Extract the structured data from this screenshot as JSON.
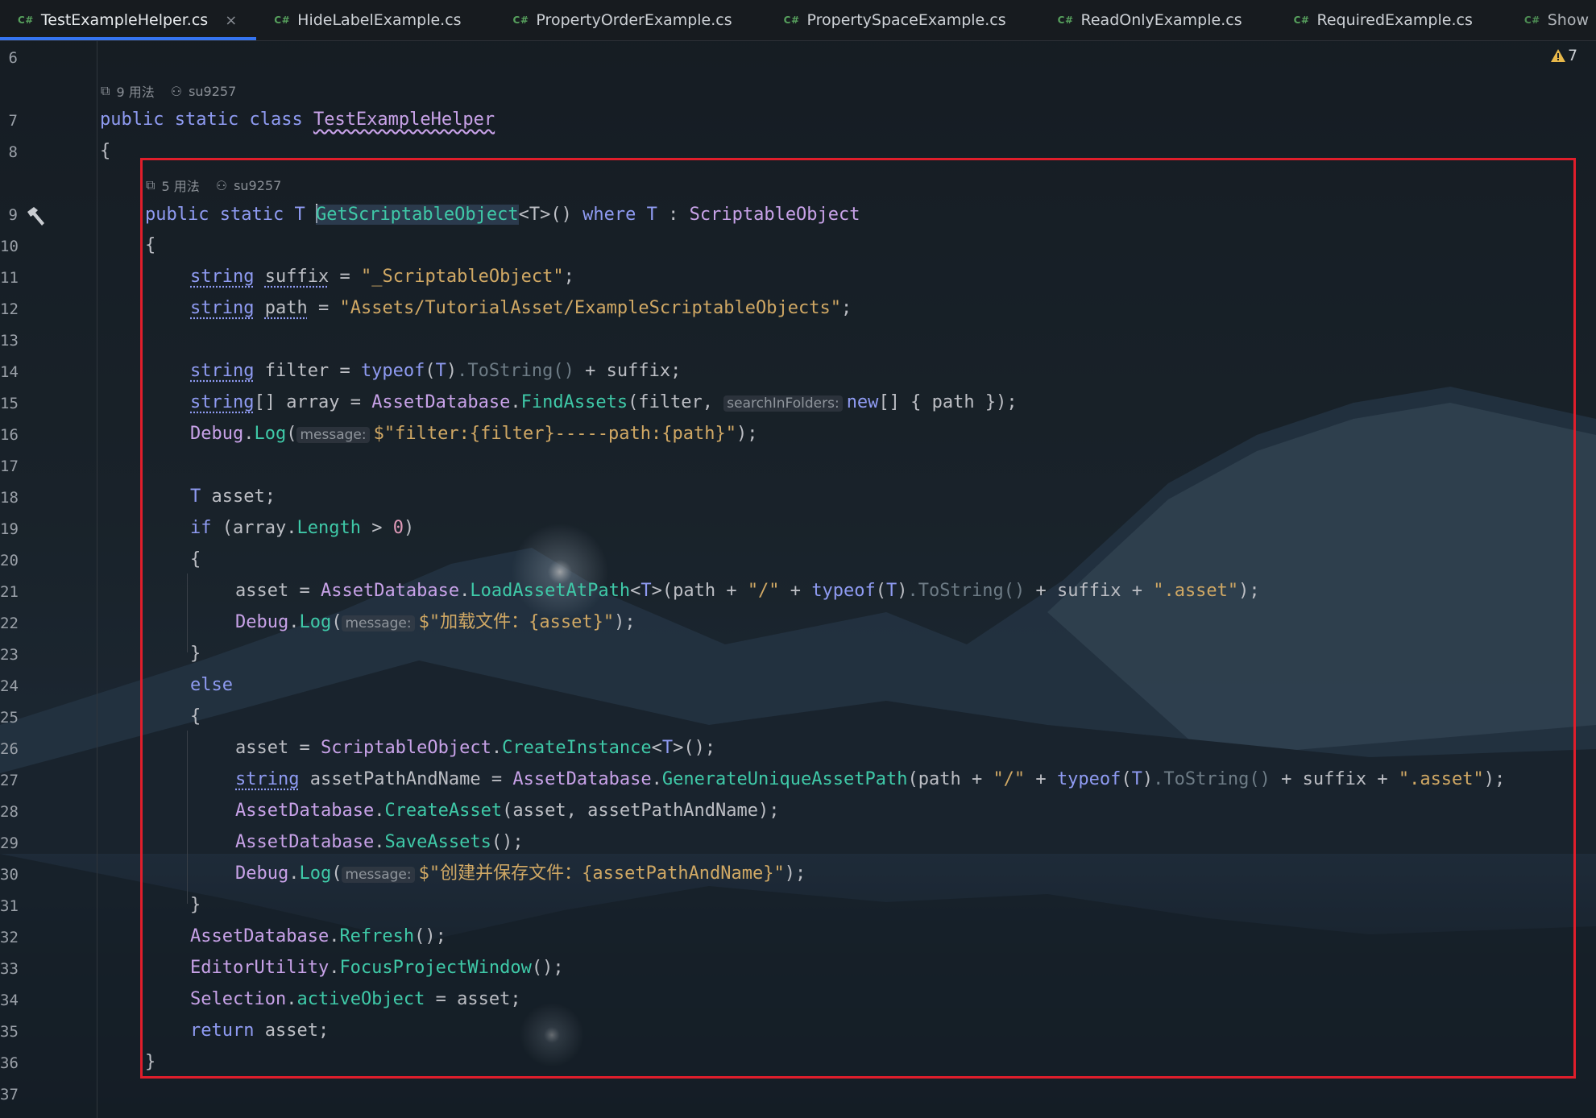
{
  "tabs": [
    {
      "lang": "C#",
      "label": "TestExampleHelper.cs",
      "active": true
    },
    {
      "lang": "C#",
      "label": "HideLabelExample.cs"
    },
    {
      "lang": "C#",
      "label": "PropertyOrderExample.cs"
    },
    {
      "lang": "C#",
      "label": "PropertySpaceExample.cs"
    },
    {
      "lang": "C#",
      "label": "ReadOnlyExample.cs"
    },
    {
      "lang": "C#",
      "label": "RequiredExample.cs"
    },
    {
      "lang": "C#",
      "label": "Show"
    }
  ],
  "tab_close_icon": "×",
  "more_tabs_icon": "chevron-down-icon",
  "warnings_count": "7",
  "class_meta": {
    "usages": "9 用法",
    "author": "su9257"
  },
  "method_meta": {
    "usages": "5 用法",
    "author": "su9257"
  },
  "line_numbers": [
    "6",
    "7",
    "8",
    "9",
    "10",
    "11",
    "12",
    "13",
    "14",
    "15",
    "16",
    "17",
    "18",
    "19",
    "20",
    "21",
    "22",
    "23",
    "24",
    "25",
    "26",
    "27",
    "28",
    "29",
    "30",
    "31",
    "32",
    "33",
    "34",
    "35",
    "36",
    "37"
  ],
  "code": {
    "l7_public": "public",
    "l7_static": "static",
    "l7_class": "class",
    "l7_name": "TestExampleHelper",
    "l8": "{",
    "l9_public": "public",
    "l9_static": "static",
    "l9_T": "T",
    "l9_name": "GetScriptableObject",
    "l9_generic": "<T>()",
    "l9_where": "where",
    "l9_T2": "T",
    "l9_colon": ":",
    "l9_base": "ScriptableObject",
    "l10": "{",
    "l11_type": "string",
    "l11_var": "suffix",
    "l11_eq": " = ",
    "l11_str": "\"_ScriptableObject\"",
    "l11_end": ";",
    "l12_type": "string",
    "l12_var": "path",
    "l12_eq": " = ",
    "l12_str": "\"Assets/TutorialAsset/ExampleScriptableObjects\"",
    "l12_end": ";",
    "l14_type": "string",
    "l14_rest1": " filter = ",
    "l14_typeof": "typeof",
    "l14_p1": "(",
    "l14_T": "T",
    "l14_p2": ")",
    "l14_tostring": ".ToString()",
    "l14_rest2": " + suffix;",
    "l15_type": "string",
    "l15_rest1": "[] array = ",
    "l15_cls": "AssetDatabase",
    "l15_dot": ".",
    "l15_fn": "FindAssets",
    "l15_rest2": "(filter, ",
    "l15_hint": "searchInFolders:",
    "l15_new": "new",
    "l15_rest3": "[] { path });",
    "l16_cls": "Debug",
    "l16_dot": ".",
    "l16_fn": "Log",
    "l16_p": "(",
    "l16_hint": "message:",
    "l16_str": "$\"filter:{filter}-----path:{path}\"",
    "l16_end": ");",
    "l18_T": "T",
    "l18_rest": " asset;",
    "l19_if": "if",
    "l19_rest1": " (array.",
    "l19_prop": "Length",
    "l19_rest2": " > ",
    "l19_num": "0",
    "l19_rest3": ")",
    "l20": "{",
    "l21_rest1": "asset = ",
    "l21_cls": "AssetDatabase",
    "l21_dot": ".",
    "l21_fn": "LoadAssetAtPath",
    "l21_gen1": "<",
    "l21_T": "T",
    "l21_gen2": ">",
    "l21_rest2": "(path + ",
    "l21_s1": "\"/\"",
    "l21_rest3": " + ",
    "l21_typeof": "typeof",
    "l21_p1": "(",
    "l21_T2": "T",
    "l21_p2": ")",
    "l21_tostring": ".ToString()",
    "l21_rest4": " + suffix + ",
    "l21_s2": "\".asset\"",
    "l21_end": ");",
    "l22_cls": "Debug",
    "l22_dot": ".",
    "l22_fn": "Log",
    "l22_p": "(",
    "l22_hint": "message:",
    "l22_str": "$\"加载文件：{asset}\"",
    "l22_end": ");",
    "l23": "}",
    "l24": "else",
    "l25": "{",
    "l26_rest1": "asset = ",
    "l26_cls": "ScriptableObject",
    "l26_dot": ".",
    "l26_fn": "CreateInstance",
    "l26_gen1": "<",
    "l26_T": "T",
    "l26_gen2": ">",
    "l26_end": "();",
    "l27_type": "string",
    "l27_rest1": " assetPathAndName = ",
    "l27_cls": "AssetDatabase",
    "l27_dot": ".",
    "l27_fn": "GenerateUniqueAssetPath",
    "l27_rest2": "(path + ",
    "l27_s1": "\"/\"",
    "l27_rest3": " + ",
    "l27_typeof": "typeof",
    "l27_p1": "(",
    "l27_T": "T",
    "l27_p2": ")",
    "l27_tostring": ".ToString()",
    "l27_rest4": " + suffix + ",
    "l27_s2": "\".asset\"",
    "l27_end": ");",
    "l28_cls": "AssetDatabase",
    "l28_dot": ".",
    "l28_fn": "CreateAsset",
    "l28_rest": "(asset, assetPathAndName);",
    "l29_cls": "AssetDatabase",
    "l29_dot": ".",
    "l29_fn": "SaveAssets",
    "l29_rest": "();",
    "l30_cls": "Debug",
    "l30_dot": ".",
    "l30_fn": "Log",
    "l30_p": "(",
    "l30_hint": "message:",
    "l30_str": "$\"创建并保存文件：{assetPathAndName}\"",
    "l30_end": ");",
    "l31": "}",
    "l32_cls": "AssetDatabase",
    "l32_dot": ".",
    "l32_fn": "Refresh",
    "l32_rest": "();",
    "l33_cls": "EditorUtility",
    "l33_dot": ".",
    "l33_fn": "FocusProjectWindow",
    "l33_rest": "();",
    "l34_cls": "Selection",
    "l34_dot": ".",
    "l34_fn": "activeObject",
    "l34_rest": " = asset;",
    "l35_kw": "return",
    "l35_rest": " asset;",
    "l36": "}"
  }
}
